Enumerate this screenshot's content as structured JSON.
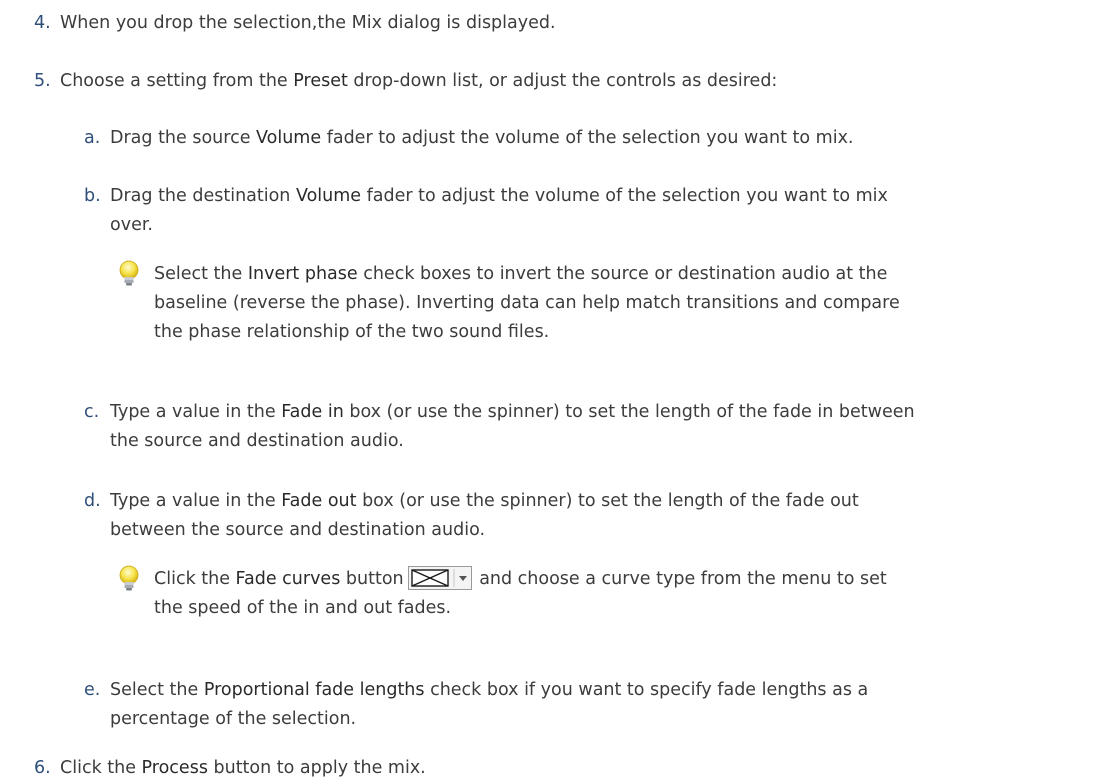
{
  "steps": [
    {
      "num": "4.",
      "text": "When you drop the selection,the Mix dialog is displayed."
    },
    {
      "num": "5.",
      "pre": "Choose a setting from the ",
      "bold": "Preset",
      "post": " drop-down list, or adjust the controls as desired:"
    },
    {
      "num": "6.",
      "pre": "Click the ",
      "bold": "Process",
      "post": " button to apply the mix."
    }
  ],
  "substeps": [
    {
      "letter": "a.",
      "pre": "Drag the source ",
      "bold": "Volume",
      "post": " fader to adjust the volume of the selection you want to mix."
    },
    {
      "letter": "b.",
      "pre": "Drag the destination ",
      "bold": "Volume",
      "post": " fader to adjust the volume of the selection you want to mix",
      "post2": "over."
    },
    {
      "letter": "c.",
      "pre": "Type a value in the ",
      "bold": "Fade in",
      "post": " box (or use the spinner) to set the length of the fade in between",
      "post2": "the source and destination audio."
    },
    {
      "letter": "d.",
      "pre": "Type a value in the ",
      "bold": "Fade out",
      "post": " box (or use the spinner) to set the length of the fade out",
      "post2": "between the source and destination audio."
    },
    {
      "letter": "e.",
      "pre": "Select the ",
      "bold": "Proportional fade lengths",
      "post": " check box if you want to specify fade lengths as a",
      "post2": "percentage of the selection."
    }
  ],
  "tips": [
    {
      "pre": "Select the ",
      "bold": "Invert phase",
      "post": " check boxes to invert the source or destination audio at the",
      "line2": "baseline (reverse the phase). Inverting data can help match transitions and compare",
      "line3": "the phase relationship of the two sound files."
    },
    {
      "pre": "Click the ",
      "bold": "Fade curves",
      "post1": " button",
      "post2": " and choose a curve type from the menu to set",
      "line2": "the speed of the in and out fades."
    }
  ],
  "icons": {
    "tip": "lightbulb-icon",
    "fade_button": "fade-curves-button-icon"
  }
}
